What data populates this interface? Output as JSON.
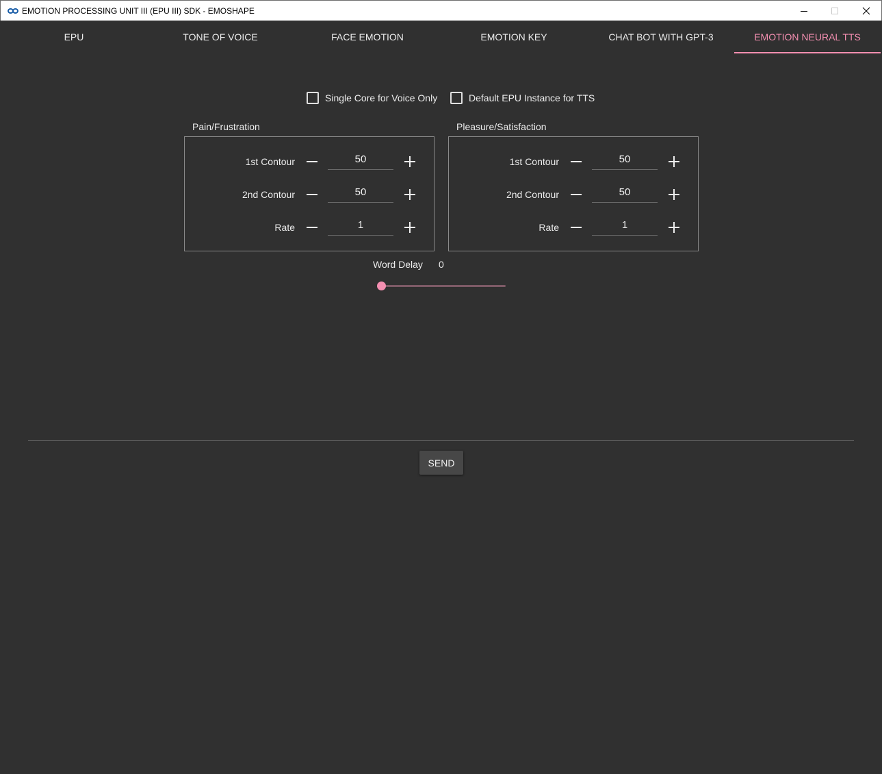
{
  "window": {
    "title": "EMOTION PROCESSING UNIT III (EPU III) SDK - EMOSHAPE",
    "app_icon": "infinity-logo-icon",
    "controls": [
      "minimize-icon",
      "maximize-icon",
      "close-icon"
    ]
  },
  "tabs": [
    {
      "label": "EPU",
      "active": false
    },
    {
      "label": "TONE OF VOICE",
      "active": false
    },
    {
      "label": "FACE EMOTION",
      "active": false
    },
    {
      "label": "EMOTION KEY",
      "active": false
    },
    {
      "label": "CHAT BOT WITH GPT-3",
      "active": false
    },
    {
      "label": "EMOTION NEURAL TTS",
      "active": true
    }
  ],
  "options": {
    "single_core": {
      "label": "Single Core for Voice Only",
      "checked": false
    },
    "default_instance": {
      "label": "Default EPU Instance for TTS",
      "checked": false
    }
  },
  "groups": [
    {
      "title": "Pain/Frustration",
      "rows": [
        {
          "label": "1st Contour",
          "value": "50"
        },
        {
          "label": "2nd Contour",
          "value": "50"
        },
        {
          "label": "Rate",
          "value": "1"
        }
      ]
    },
    {
      "title": "Pleasure/Satisfaction",
      "rows": [
        {
          "label": "1st Contour",
          "value": "50"
        },
        {
          "label": "2nd Contour",
          "value": "50"
        },
        {
          "label": "Rate",
          "value": "1"
        }
      ]
    }
  ],
  "word_delay": {
    "label": "Word Delay",
    "value": "0",
    "fraction": 0
  },
  "send_label": "SEND",
  "colors": {
    "background": "#303030",
    "accent": "#f48fb1",
    "slider_track": "#7d5a66",
    "text": "#ececec",
    "titlebar": "#ffffff"
  }
}
